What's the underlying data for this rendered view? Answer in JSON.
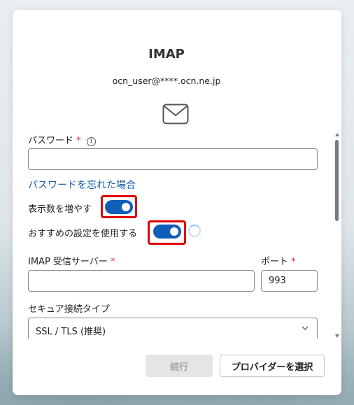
{
  "dialog": {
    "title": "IMAP",
    "email": "ocn_user@****.ocn.ne.jp"
  },
  "password": {
    "label": "パスワード",
    "required_mark": "*",
    "info_icon": "i",
    "value": "",
    "forgot_link": "パスワードを忘れた場合"
  },
  "toggles": {
    "show_more_label": "表示数を増やす",
    "show_more_on": true,
    "recommended_label": "おすすめの設定を使用する",
    "recommended_on": true
  },
  "server": {
    "label": "IMAP 受信サーバー",
    "required_mark": "*",
    "value": ""
  },
  "port": {
    "label": "ポート",
    "required_mark": "*",
    "value": "993"
  },
  "security": {
    "label": "セキュア接続タイプ",
    "selected": "SSL / TLS (推奨)"
  },
  "buttons": {
    "continue": "続行",
    "choose_provider": "プロバイダーを選択"
  },
  "colors": {
    "accent": "#0f5fb8",
    "link": "#1a5fa8",
    "highlight": "#e00000",
    "required": "#d13438"
  },
  "icons": [
    "mail-icon",
    "info-icon",
    "chevron-down-icon",
    "spinner-icon"
  ]
}
